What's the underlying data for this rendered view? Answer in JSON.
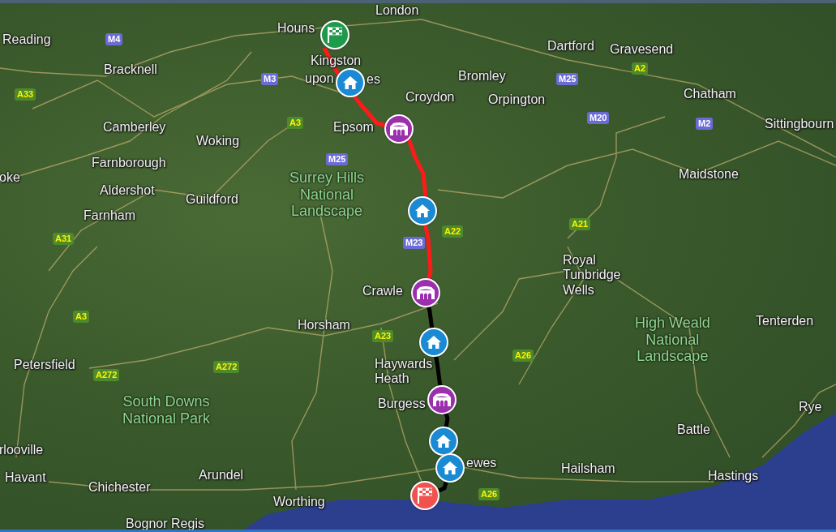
{
  "map": {
    "labels": [
      {
        "kind": "town",
        "lines": [
          "London"
        ]
      },
      {
        "kind": "town",
        "lines": [
          "Reading"
        ]
      },
      {
        "kind": "town",
        "lines": [
          "Bracknell"
        ]
      },
      {
        "kind": "town",
        "lines": [
          "Houns"
        ]
      },
      {
        "kind": "town",
        "lines": [
          "Kingston"
        ]
      },
      {
        "kind": "town",
        "lines": [
          "upon"
        ]
      },
      {
        "kind": "town",
        "lines": [
          "es"
        ]
      },
      {
        "kind": "town",
        "lines": [
          "Camberley"
        ]
      },
      {
        "kind": "town",
        "lines": [
          "Woking"
        ]
      },
      {
        "kind": "town",
        "lines": [
          "Farnborough"
        ]
      },
      {
        "kind": "town",
        "lines": [
          "oke"
        ]
      },
      {
        "kind": "town",
        "lines": [
          "Aldershot"
        ]
      },
      {
        "kind": "town",
        "lines": [
          "Guildford"
        ]
      },
      {
        "kind": "town",
        "lines": [
          "Farnham"
        ]
      },
      {
        "kind": "town",
        "lines": [
          "Epsom"
        ]
      },
      {
        "kind": "town",
        "lines": [
          "Croydon"
        ]
      },
      {
        "kind": "town",
        "lines": [
          "Bromley"
        ]
      },
      {
        "kind": "town",
        "lines": [
          "Orpington"
        ]
      },
      {
        "kind": "town",
        "lines": [
          "Dartford"
        ]
      },
      {
        "kind": "town",
        "lines": [
          "Gravesend"
        ]
      },
      {
        "kind": "town",
        "lines": [
          "Chatham"
        ]
      },
      {
        "kind": "town",
        "lines": [
          "Sittingbourn"
        ]
      },
      {
        "kind": "town",
        "lines": [
          "Maidstone"
        ]
      },
      {
        "kind": "town",
        "lines": [
          "Crawle"
        ]
      },
      {
        "kind": "town",
        "lines": [
          "Royal",
          "Tunbridge",
          "Wells"
        ]
      },
      {
        "kind": "town",
        "lines": [
          "Horsham"
        ]
      },
      {
        "kind": "town",
        "lines": [
          "Tenterden"
        ]
      },
      {
        "kind": "town",
        "lines": [
          "Petersfield"
        ]
      },
      {
        "kind": "town",
        "lines": [
          "Haywards",
          "Heath"
        ]
      },
      {
        "kind": "town",
        "lines": [
          "Burgess"
        ]
      },
      {
        "kind": "town",
        "lines": [
          "Rye"
        ]
      },
      {
        "kind": "town",
        "lines": [
          "Battle"
        ]
      },
      {
        "kind": "town",
        "lines": [
          "rlooville"
        ]
      },
      {
        "kind": "town",
        "lines": [
          "ewes"
        ]
      },
      {
        "kind": "town",
        "lines": [
          "Hailsham"
        ]
      },
      {
        "kind": "town",
        "lines": [
          "Havant"
        ]
      },
      {
        "kind": "town",
        "lines": [
          "Arundel"
        ]
      },
      {
        "kind": "town",
        "lines": [
          "Hastings"
        ]
      },
      {
        "kind": "town",
        "lines": [
          "Chichester"
        ]
      },
      {
        "kind": "town",
        "lines": [
          "Worthing"
        ]
      },
      {
        "kind": "town",
        "lines": [
          "Bognor Regis"
        ]
      },
      {
        "kind": "park",
        "lines": [
          "Surrey Hills",
          "National",
          "Landscape"
        ]
      },
      {
        "kind": "park",
        "lines": [
          "South Downs",
          "National Park"
        ]
      },
      {
        "kind": "park",
        "lines": [
          "High Weald",
          "National",
          "Landscape"
        ]
      },
      {
        "kind": "motorway",
        "lines": [
          "M4"
        ]
      },
      {
        "kind": "motorway",
        "lines": [
          "M3"
        ]
      },
      {
        "kind": "aroad",
        "lines": [
          "A33"
        ]
      },
      {
        "kind": "aroad",
        "lines": [
          "A3"
        ]
      },
      {
        "kind": "motorway",
        "lines": [
          "M25"
        ]
      },
      {
        "kind": "motorway",
        "lines": [
          "M25"
        ]
      },
      {
        "kind": "aroad",
        "lines": [
          "A2"
        ]
      },
      {
        "kind": "motorway",
        "lines": [
          "M20"
        ]
      },
      {
        "kind": "motorway",
        "lines": [
          "M2"
        ]
      },
      {
        "kind": "aroad",
        "lines": [
          "A22"
        ]
      },
      {
        "kind": "motorway",
        "lines": [
          "M23"
        ]
      },
      {
        "kind": "aroad",
        "lines": [
          "A21"
        ]
      },
      {
        "kind": "aroad",
        "lines": [
          "A31"
        ]
      },
      {
        "kind": "aroad",
        "lines": [
          "A3"
        ]
      },
      {
        "kind": "aroad",
        "lines": [
          "A272"
        ]
      },
      {
        "kind": "aroad",
        "lines": [
          "A272"
        ]
      },
      {
        "kind": "aroad",
        "lines": [
          "A23"
        ]
      },
      {
        "kind": "aroad",
        "lines": [
          "A26"
        ]
      },
      {
        "kind": "aroad",
        "lines": [
          "A26"
        ]
      }
    ],
    "route": [
      {
        "color": "#ff1a1a"
      },
      {
        "color": "#000000"
      }
    ],
    "markers": [
      {
        "kind": "start"
      },
      {
        "kind": "home"
      },
      {
        "kind": "venue"
      },
      {
        "kind": "home"
      },
      {
        "kind": "venue"
      },
      {
        "kind": "home"
      },
      {
        "kind": "venue"
      },
      {
        "kind": "home"
      },
      {
        "kind": "home"
      },
      {
        "kind": "finish"
      }
    ]
  }
}
